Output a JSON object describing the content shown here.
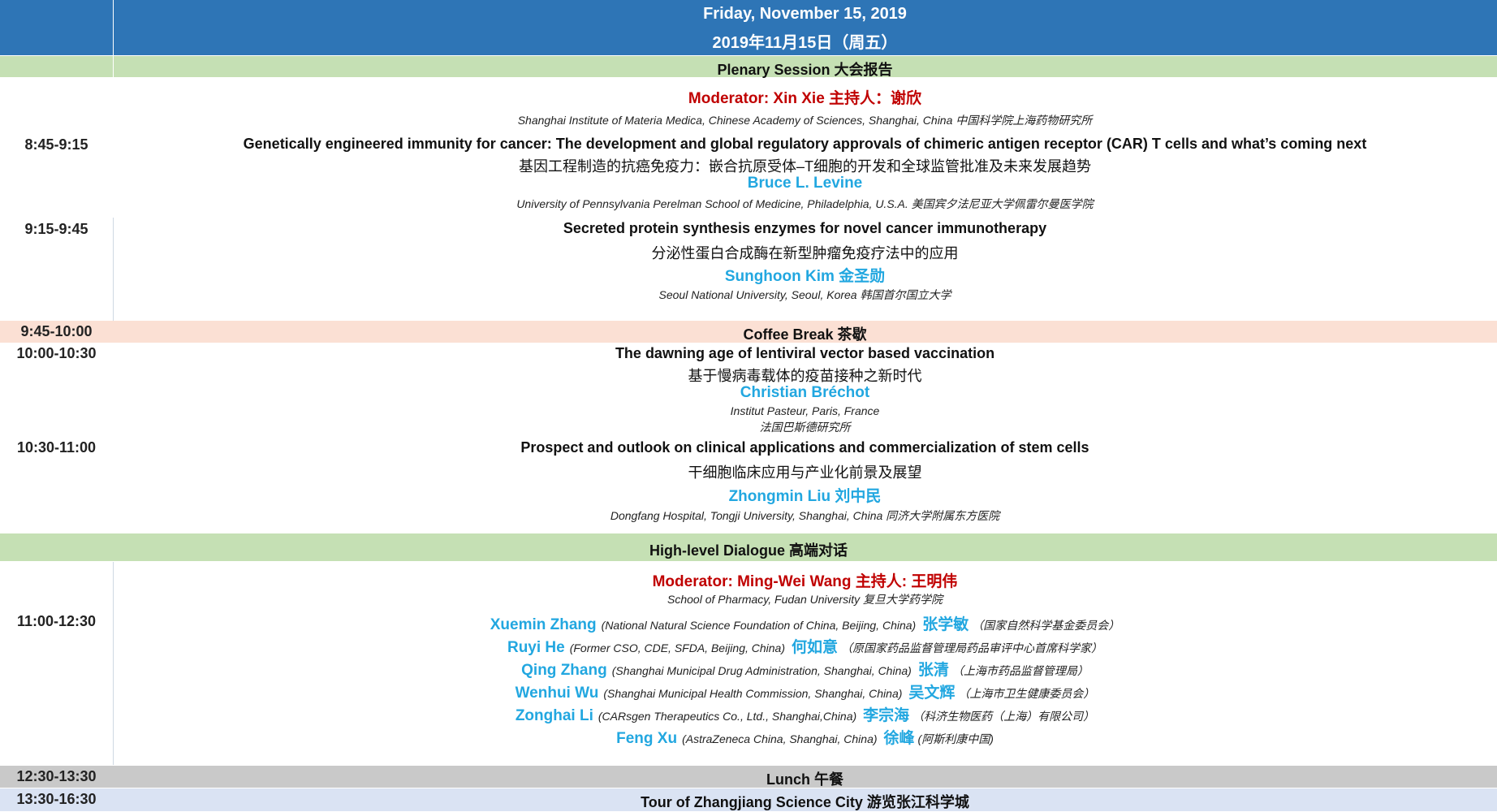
{
  "header": {
    "date_en": "Friday, November 15, 2019",
    "date_zh": "2019年11月15日（周五）",
    "bg": "#2e75b6"
  },
  "plenary": {
    "label": "Plenary Session 大会报告",
    "bg": "#c5e0b4"
  },
  "block1": {
    "moderator": "Moderator: Xin Xie  主持人：谢欣",
    "moderator_aff": "Shanghai Institute of Materia Medica, Chinese Academy of Sciences, Shanghai, China   中国科学院上海药物研究所",
    "time": "8:45-9:15",
    "title_en": "Genetically engineered immunity for cancer: The development and global regulatory approvals of chimeric antigen receptor (CAR) T cells and what’s coming next",
    "title_zh": "基因工程制造的抗癌免疫力：嵌合抗原受体–T细胞的开发和全球监管批准及未来发展趋势",
    "speaker": "Bruce L. Levine",
    "aff": "University of Pennsylvania Perelman School of Medicine, Philadelphia,  U.S.A. 美国宾夕法尼亚大学佩雷尔曼医学院"
  },
  "block2": {
    "time": "9:15-9:45",
    "title_en": "Secreted protein synthesis enzymes for novel cancer immunotherapy",
    "title_zh": "分泌性蛋白合成酶在新型肿瘤免疫疗法中的应用",
    "speaker": "Sunghoon Kim 金圣勋",
    "aff": "Seoul National University, Seoul, Korea  韩国首尔国立大学"
  },
  "coffee": {
    "time": "9:45-10:00",
    "label": "Coffee Break 茶歇",
    "bg": "#fbe0d4"
  },
  "block3": {
    "time": "10:00-10:30",
    "title_en": "The dawning age of lentiviral vector based vaccination",
    "title_zh": "基于慢病毒载体的疫苗接种之新时代",
    "speaker": "Christian Bréchot",
    "aff_en": "Institut Pasteur, Paris, France",
    "aff_zh": "法国巴斯德研究所"
  },
  "block4": {
    "time": "10:30-11:00",
    "title_en": "Prospect and outlook on clinical applications and commercialization of stem cells",
    "title_zh": "干细胞临床应用与产业化前景及展望",
    "speaker": "Zhongmin Liu 刘中民",
    "aff": "Dongfang Hospital, Tongji University, Shanghai, China   同济大学附属东方医院"
  },
  "dialogue": {
    "label": "High-level Dialogue 高端对话",
    "bg": "#c5e0b4"
  },
  "block5": {
    "time": "11:00-12:30",
    "moderator": "Moderator: Ming-Wei Wang 主持人: 王明伟",
    "moderator_aff": "School of Pharmacy, Fudan University  复旦大学药学院",
    "panel": [
      {
        "name": "Xuemin Zhang",
        "aff": "(National Natural Science Foundation of China, Beijing, China)",
        "name_zh": "张学敏",
        "aff_zh": "（国家自然科学基金委员会）"
      },
      {
        "name": "Ruyi He",
        "aff": "(Former CSO, CDE, SFDA, Beijing, China)",
        "name_zh": "何如意",
        "aff_zh": "（原国家药品监督管理局药品审评中心首席科学家）"
      },
      {
        "name": "Qing Zhang",
        "aff": "(Shanghai Municipal Drug Administration, Shanghai, China)",
        "name_zh": "张清",
        "aff_zh": "（上海市药品监督管理局）"
      },
      {
        "name": "Wenhui Wu",
        "aff": "(Shanghai Municipal Health Commission, Shanghai, China)",
        "name_zh": "吴文辉",
        "aff_zh": "（上海市卫生健康委员会）"
      },
      {
        "name": "Zonghai Li",
        "aff": "(CARsgen Therapeutics Co., Ltd., Shanghai,China)",
        "name_zh": "李宗海",
        "aff_zh": "（科济生物医药（上海）有限公司）"
      },
      {
        "name": "Feng Xu",
        "aff": "(AstraZeneca China, Shanghai, China)",
        "name_zh": "徐峰",
        "aff_zh": "(阿斯利康中国)"
      }
    ]
  },
  "lunch": {
    "time": "12:30-13:30",
    "label": "Lunch 午餐",
    "bg": "#c9c9c9"
  },
  "tour": {
    "time": "13:30-16:30",
    "label": "Tour of Zhangjiang Science City  游览张江科学城",
    "bg": "#dae3f3"
  }
}
